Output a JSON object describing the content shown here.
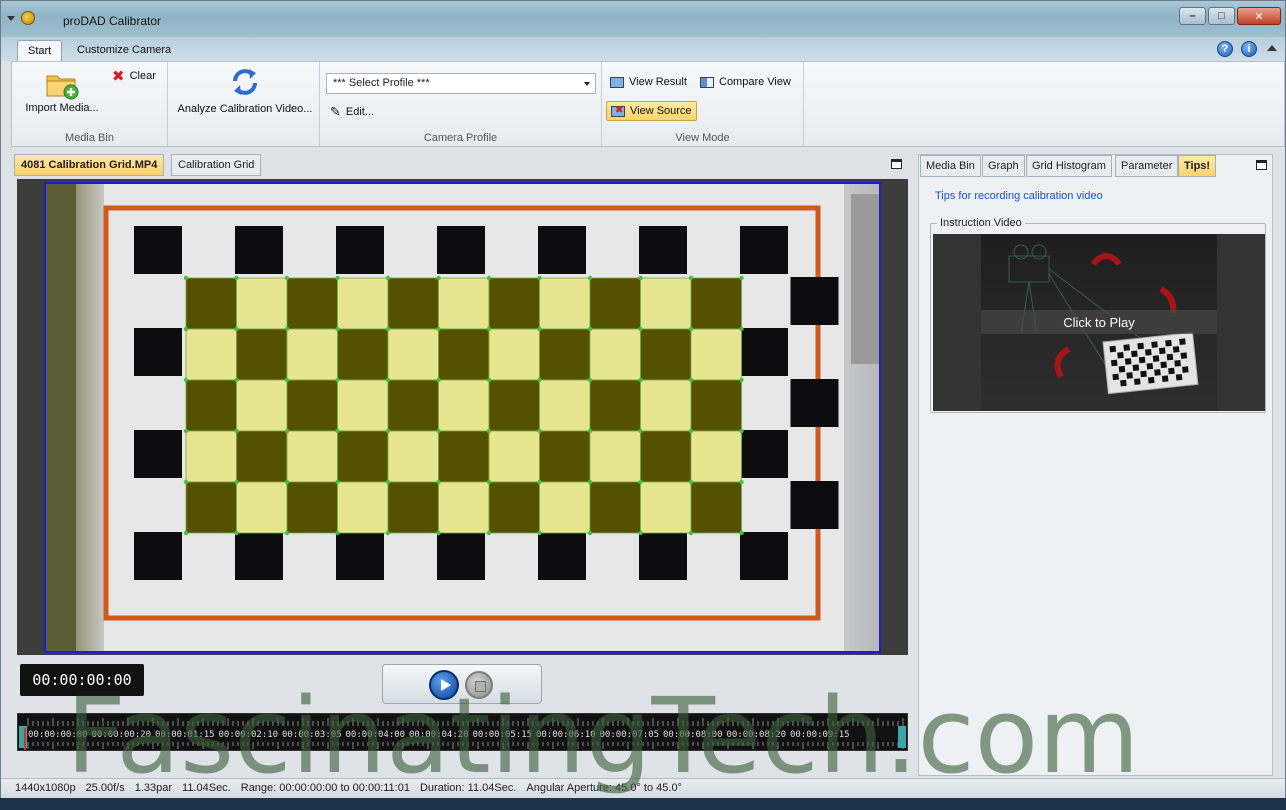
{
  "window": {
    "title": "proDAD Calibrator"
  },
  "ribbon_tabs": [
    "Start",
    "Customize Camera"
  ],
  "ribbon": {
    "media_bin": {
      "import_label": "Import Media...",
      "clear_label": "Clear",
      "group_label": "Media Bin"
    },
    "analyze_label": "Analyze Calibration Video...",
    "camera_profile": {
      "select_value": "*** Select Profile ***",
      "edit_label": "Edit...",
      "group_label": "Camera Profile"
    },
    "view_mode": {
      "view_result": "View Result",
      "compare_view": "Compare View",
      "view_source": "View Source",
      "group_label": "View Mode"
    }
  },
  "left_tabs": [
    "4081 Calibration Grid.MP4",
    "Calibration Grid"
  ],
  "player": {
    "timecode": "00:00:00:00",
    "timeline_labels": [
      "00:00:00:00",
      "00:00:00:20",
      "00:00:01:15",
      "00:00:02:10",
      "00:00:03:05",
      "00:00:04:00",
      "00:00:04:20",
      "00:00:05:15",
      "00:00:06:10",
      "00:00:07:05",
      "00:00:08:00",
      "00:00:08:20",
      "00:00:09:15"
    ]
  },
  "right_tabs": [
    "Media Bin",
    "Graph",
    "Grid Histogram",
    "Parameter",
    "Tips!"
  ],
  "tips": {
    "link": "Tips for recording calibration video",
    "instruction_legend": "Instruction Video",
    "click_to_play": "Click to Play"
  },
  "status": {
    "resolution": "1440x1080p",
    "fps": "25.00f/s",
    "par": "1.33par",
    "length": "11.04Sec.",
    "range": "Range: 00:00:00:00 to 00:00:11:01",
    "duration": "Duration: 11.04Sec.",
    "aperture": "Angular Aperture: 45.0° to 45.0°"
  },
  "watermark": "FascinatingTech.com",
  "colors": {
    "accent_tab": "#fcd46e",
    "grid_dark": "#545200",
    "grid_light": "#e6e690",
    "video_border": "#1b1bd8"
  }
}
